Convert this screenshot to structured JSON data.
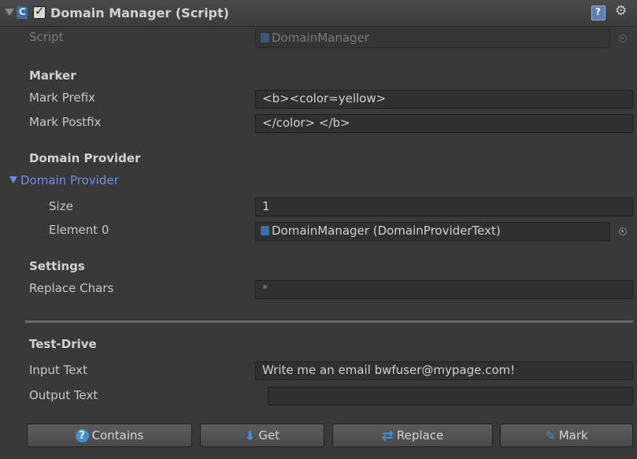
{
  "component": {
    "title": "Domain Manager (Script)",
    "enabled": true,
    "script_label": "Script",
    "script_value": "DomainManager"
  },
  "marker": {
    "heading": "Marker",
    "prefix_label": "Mark Prefix",
    "prefix_value": "<b><color=yellow>",
    "postfix_label": "Mark Postfix",
    "postfix_value": "</color> </b>"
  },
  "domain_provider": {
    "heading": "Domain Provider",
    "foldout_label": "Domain Provider",
    "size_label": "Size",
    "size_value": "1",
    "element0_label": "Element 0",
    "element0_value": "DomainManager (DomainProviderText)"
  },
  "settings": {
    "heading": "Settings",
    "replace_chars_label": "Replace Chars",
    "replace_chars_value": "*"
  },
  "test_drive": {
    "heading": "Test-Drive",
    "input_label": "Input Text",
    "input_value": "Write me an email bwfuser@mypage.com!",
    "output_label": "Output Text",
    "output_value": ""
  },
  "buttons": {
    "contains": "Contains",
    "get": "Get",
    "replace": "Replace",
    "mark": "Mark"
  },
  "colors": {
    "background": "#393939",
    "accent_blue": "#3d8fd6",
    "foldout_blue": "#6b8fe6"
  }
}
